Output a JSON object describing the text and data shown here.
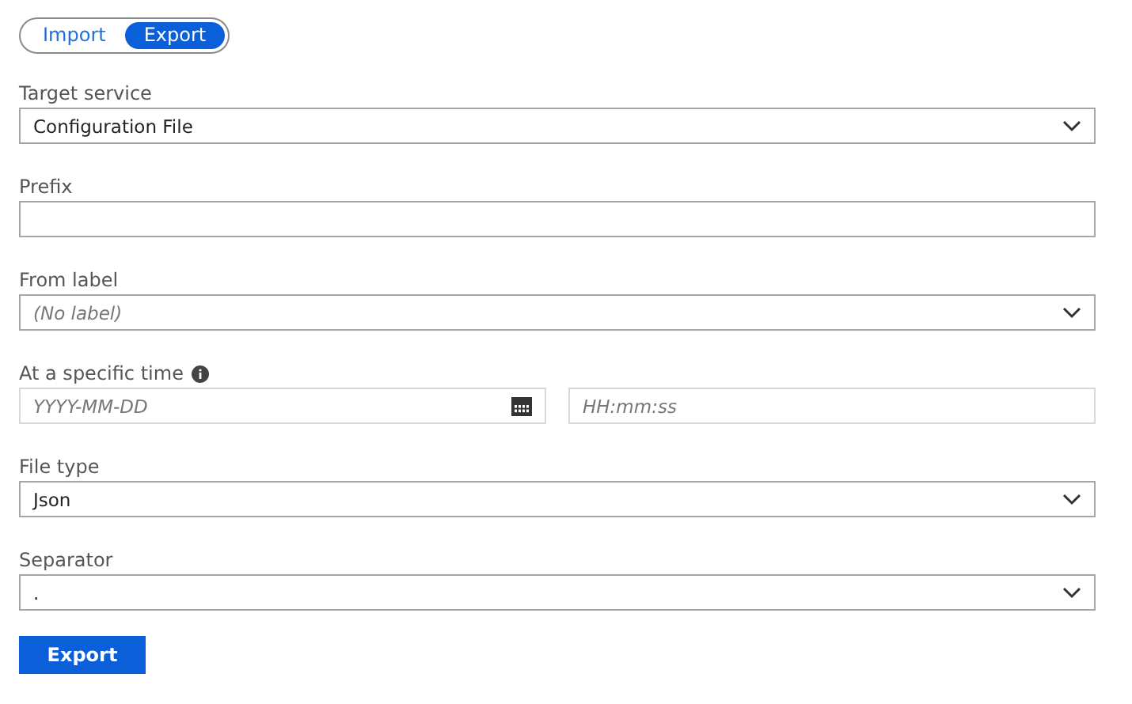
{
  "mode_toggle": [
    {
      "label": "Import",
      "selected": false
    },
    {
      "label": "Export",
      "selected": true
    }
  ],
  "fields": [
    {
      "kind": "select",
      "label": "Target service",
      "value": "Configuration File"
    },
    {
      "kind": "input",
      "label": "Prefix"
    },
    {
      "kind": "select",
      "label": "From label",
      "placeholder": "(No label)"
    },
    {
      "kind": "datetime",
      "label": "At a specific time",
      "info": true,
      "date_placeholder": "YYYY-MM-DD",
      "time_placeholder": "HH:mm:ss"
    },
    {
      "kind": "select",
      "label": "File type",
      "value": "Json"
    },
    {
      "kind": "select",
      "label": "Separator",
      "value": "."
    }
  ],
  "submit_button": "Export"
}
